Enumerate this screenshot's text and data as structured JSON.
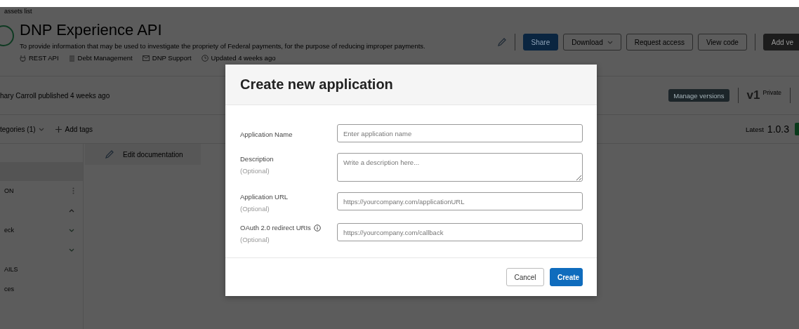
{
  "breadcrumb": "assets list",
  "api": {
    "title": "DNP Experience API",
    "description": "To provide information that may be used to investigate the propriety of Federal payments, for the purpose of reducing improper payments.",
    "meta": [
      {
        "kind": "api",
        "text": "REST API"
      },
      {
        "kind": "category",
        "text": "Debt Management"
      },
      {
        "kind": "contact",
        "text": "DNP Support"
      },
      {
        "kind": "updated",
        "text": "Updated 4 weeks ago"
      }
    ]
  },
  "actions": [
    {
      "label": "Share",
      "kind": "primary"
    },
    {
      "label": "Download",
      "kind": "dropdown"
    },
    {
      "label": "Request access",
      "kind": "outline"
    },
    {
      "label": "View code",
      "kind": "outline"
    },
    {
      "label": "Add ve",
      "kind": "dark"
    }
  ],
  "publish_note": "hary Carroll published 4 weeks ago",
  "manage_versions": "Manage versions",
  "version": {
    "name": "v1",
    "visibility": "Private"
  },
  "categories": "tegories (1)",
  "add_tags": "Add tags",
  "latest": {
    "label": "Latest",
    "value": "1.0.3"
  },
  "edit_documentation": "Edit documentation",
  "sidebar": {
    "items": [
      {
        "label": "ON",
        "kind": "menu"
      },
      {
        "kind": "group",
        "expanded": true
      },
      {
        "label": "eck",
        "kind": "group",
        "expanded": false
      },
      {
        "kind": "group",
        "expanded": false
      },
      {
        "label": "AILS",
        "kind": "plain"
      },
      {
        "label": "ces",
        "kind": "plain"
      }
    ]
  },
  "dialog": {
    "title": "Create new application",
    "fields": [
      {
        "label": "Application Name",
        "kind": "text",
        "placeholder": "Enter application name",
        "info": false
      },
      {
        "label": "Description",
        "optional": "(Optional)",
        "kind": "textarea",
        "placeholder": "Write a description here...",
        "info": false
      },
      {
        "label": "Application URL",
        "optional": "(Optional)",
        "kind": "text",
        "placeholder": "https://yourcompany.com/applicationURL",
        "info": false
      },
      {
        "label": "OAuth 2.0 redirect URIs",
        "optional": "(Optional)",
        "kind": "text",
        "placeholder": "https://yourcompany.com/callback",
        "info": true
      }
    ],
    "buttons": [
      {
        "label": "Cancel",
        "kind": "secondary"
      },
      {
        "label": "Create",
        "kind": "primary"
      }
    ]
  }
}
